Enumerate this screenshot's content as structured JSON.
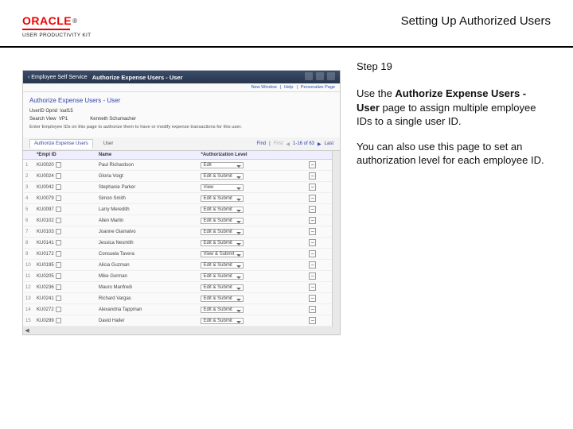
{
  "header": {
    "brand": "ORACLE",
    "subbrand": "USER PRODUCTIVITY KIT",
    "pageTitle": "Setting Up Authorized Users"
  },
  "instructions": {
    "stepLabel": "Step 19",
    "para1a": "Use the ",
    "para1bold": "Authorize Expense Users - User",
    "para1b": " page to assign multiple employee IDs to a single user ID.",
    "para2": "You can also use this page to set an authorization level for each employee ID."
  },
  "app": {
    "backLabel": "Employee Self Service",
    "barTitle": "Authorize Expense Users - User",
    "subLinks": [
      "New Window",
      "Help",
      "Personalize Page"
    ],
    "pageHeading": "Authorize Expense Users - User",
    "userIdLabel": "UserID Oprid",
    "userIdValue": "loaf15",
    "searchViewLabel": "Search View",
    "searchViewValue": "VP1",
    "searchDesc": "Kenneth Schumacher",
    "hint": "Enter Employee IDs on this page to authorize them to have or modify expense transactions for this user.",
    "tabs": {
      "main": "Authorize Expense Users",
      "secondary": "User"
    },
    "pager": {
      "find": "Find",
      "first": "First",
      "range": "1-16 of 63",
      "last": "Last"
    },
    "columns": {
      "emplid": "*Empl ID",
      "name": "Name",
      "level": "*Authorization Level"
    },
    "rows": [
      {
        "n": "1",
        "id": "KU0020",
        "name": "Paul Richardson",
        "level": "Edit"
      },
      {
        "n": "2",
        "id": "KU0024",
        "name": "Gloria Voigt",
        "level": "Edit & Submit"
      },
      {
        "n": "3",
        "id": "KU0042",
        "name": "Stephanie Parker",
        "level": "View"
      },
      {
        "n": "4",
        "id": "KU0079",
        "name": "Simon Smith",
        "level": "Edit & Submit"
      },
      {
        "n": "5",
        "id": "KU0097",
        "name": "Larry Meredith",
        "level": "Edit & Submit"
      },
      {
        "n": "6",
        "id": "KU0102",
        "name": "Allen Marlin",
        "level": "Edit & Submit"
      },
      {
        "n": "7",
        "id": "KU0103",
        "name": "Joanne Giamalvo",
        "level": "Edit & Submit"
      },
      {
        "n": "8",
        "id": "KU0141",
        "name": "Jessica Nesmith",
        "level": "Edit & Submit"
      },
      {
        "n": "9",
        "id": "KU0172",
        "name": "Consuela Tavera",
        "level": "View & Submit"
      },
      {
        "n": "10",
        "id": "KU0195",
        "name": "Alicia Guzman",
        "level": "Edit & Submit"
      },
      {
        "n": "11",
        "id": "KU0205",
        "name": "Mike Gorman",
        "level": "Edit & Submit"
      },
      {
        "n": "12",
        "id": "KU0236",
        "name": "Mauro Manfredi",
        "level": "Edit & Submit"
      },
      {
        "n": "13",
        "id": "KU0241",
        "name": "Richard Vargas",
        "level": "Edit & Submit"
      },
      {
        "n": "14",
        "id": "KU0272",
        "name": "Alexandria Tappman",
        "level": "Edit & Submit"
      },
      {
        "n": "15",
        "id": "KU0299",
        "name": "David Haller",
        "level": "Edit & Submit"
      }
    ]
  }
}
